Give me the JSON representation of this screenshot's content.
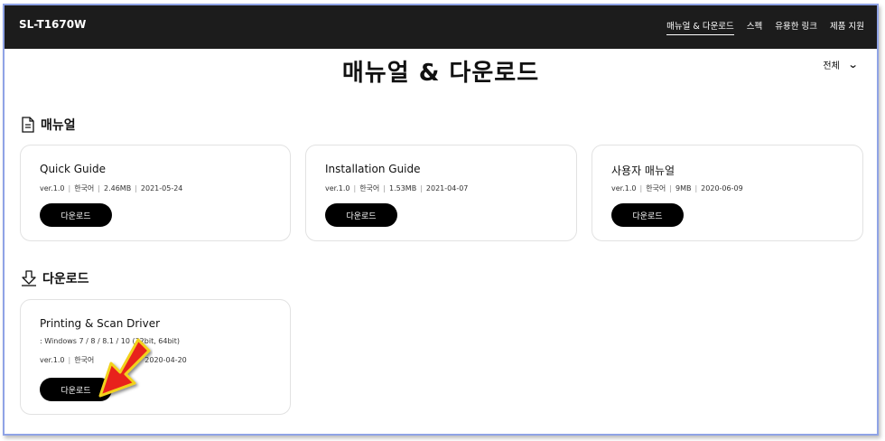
{
  "header": {
    "model": "SL-T1670W",
    "nav": [
      {
        "label": "매뉴얼 & 다운로드",
        "active": true
      },
      {
        "label": "스펙",
        "active": false
      },
      {
        "label": "유용한 링크",
        "active": false
      },
      {
        "label": "제품 지원",
        "active": false
      }
    ]
  },
  "page": {
    "title": "매뉴얼 & 다운로드",
    "filter": {
      "selected": "전체"
    }
  },
  "manuals": {
    "heading": "매뉴얼",
    "cards": [
      {
        "title": "Quick Guide",
        "version": "ver.1.0",
        "language": "한국어",
        "size": "2.46MB",
        "date": "2021-05-24",
        "button": "다운로드"
      },
      {
        "title": "Installation Guide",
        "version": "ver.1.0",
        "language": "한국어",
        "size": "1.53MB",
        "date": "2021-04-07",
        "button": "다운로드"
      },
      {
        "title": "사용자 매뉴얼",
        "version": "ver.1.0",
        "language": "한국어",
        "size": "9MB",
        "date": "2020-06-09",
        "button": "다운로드"
      }
    ]
  },
  "downloads": {
    "heading": "다운로드",
    "cards": [
      {
        "title": "Printing & Scan Driver",
        "os": ": Windows 7 / 8 / 8.1 / 10 (32bit, 64bit)",
        "version": "ver.1.0",
        "language": "한국어",
        "date": "2020-04-20",
        "button": "다운로드"
      }
    ]
  },
  "annotation": {
    "arrow_color": "#e8231f",
    "arrow_border": "#f2d21b"
  }
}
